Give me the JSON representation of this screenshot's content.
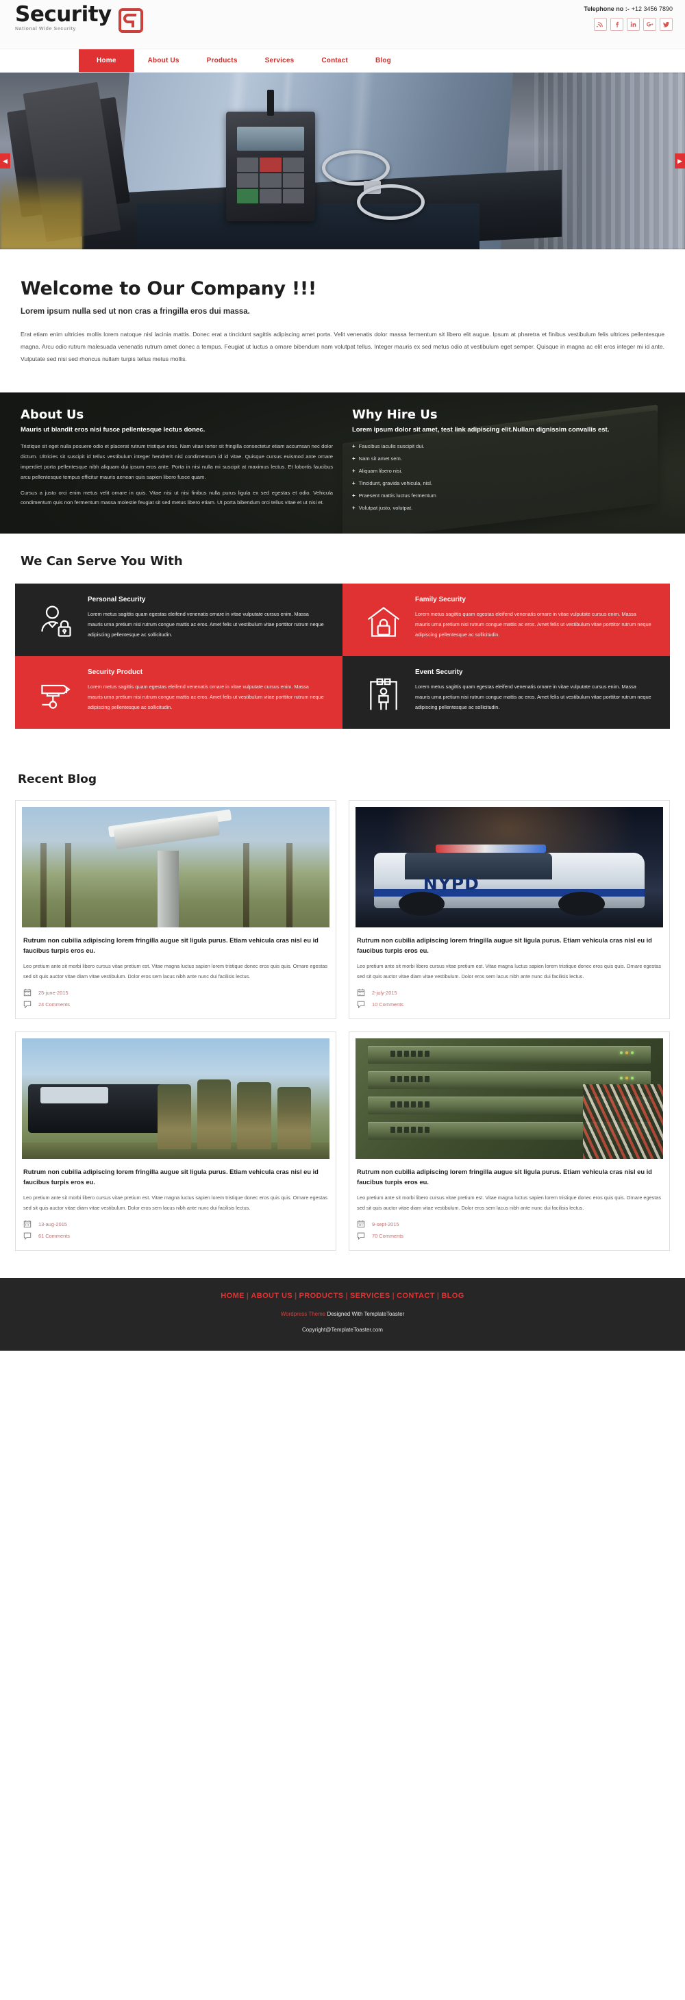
{
  "brand": {
    "name": "Security",
    "tagline": "National Wide Security",
    "accent_color": "#e03232",
    "dark_color": "#232323"
  },
  "header": {
    "telephone_label": "Telephone no :-",
    "telephone_number": "+12 3456 7890",
    "social": [
      {
        "name": "rss-icon",
        "glyph": "RSS"
      },
      {
        "name": "facebook-icon",
        "glyph": "f"
      },
      {
        "name": "linkedin-icon",
        "glyph": "in"
      },
      {
        "name": "googleplus-icon",
        "glyph": "g+"
      },
      {
        "name": "twitter-icon",
        "glyph": "tw"
      }
    ]
  },
  "nav": {
    "items": [
      {
        "label": "Home",
        "active": true
      },
      {
        "label": "About Us",
        "active": false
      },
      {
        "label": "Products",
        "active": false
      },
      {
        "label": "Services",
        "active": false
      },
      {
        "label": "Contact",
        "active": false
      },
      {
        "label": "Blog",
        "active": false
      }
    ]
  },
  "hero": {
    "prev_label": "◀",
    "next_label": "▶",
    "image_description": "Police officer duty belt with radio and handcuffs"
  },
  "welcome": {
    "title": "Welcome to Our Company  !!!",
    "subtitle": "Lorem ipsum nulla sed ut non cras a fringilla eros dui massa.",
    "body": "Erat etiam enim ultricies mollis lorem natoque nisl lacinia mattis. Donec erat a tincidunt sagittis adipiscing amet porta. Velit venenatis dolor massa fermentum sit libero elit augue. Ipsum at pharetra et finibus vestibulum felis ultrices pellentesque magna. Arcu odio rutrum malesuada venenatis rutrum amet donec a tempus. Feugiat ut luctus a ornare bibendum nam volutpat tellus. Integer mauris ex sed metus odio at vestibulum eget semper. Quisque in magna ac elit eros integer mi id ante. Vulputate sed nisi sed rhoncus nullam turpis tellus metus mollis."
  },
  "about": {
    "title": "About Us",
    "subtitle": "Mauris ut blandit eros nisi fusce pellentesque lectus donec.",
    "paragraph1": "Tristique sit eget nulla posuere odio et placerat rutrum tristique eros. Nam vitae tortor sit fringilla consectetur etiam accumsan nec dolor dictum. Ultricies sit suscipit id tellus vestibulum integer hendrerit nisl condimentum id id vitae. Quisque cursus euismod ante ornare imperdiet porta pellentesque nibh aliquam dui ipsum eros ante. Porta in nisi nulla mi suscipit at maximus lectus. Et lobortis faucibus arcu pellentesque tempus efficitur mauris aenean quis sapien libero fusce quam.",
    "paragraph2": "Cursus a justo orci enim metus velit ornare in quis. Vitae nisi ut nisi finibus nulla purus ligula ex sed egestas et odio. Vehicula condimentum quis non fermentum massa molestie feugiat sit sed metus libero etiam. Ut porta bibendum orci tellus vitae et ut nisi et."
  },
  "why_hire": {
    "title": "Why Hire Us",
    "subtitle": "Lorem ipsum dolor sit amet, test link adipiscing elit.Nullam dignissim convallis est.",
    "bullet_marker": "+",
    "items": [
      "Faucibus iaculis suscipit dui.",
      "Nam sit amet sem.",
      "Aliquam libero nisi.",
      "Tincidunt, gravida vehicula, nisl.",
      "Praesent mattis luctus fermentum",
      "Volutpat justo, volutpat."
    ]
  },
  "services": {
    "title": "We Can Serve You With",
    "shared_body": "Lorem metus sagittis quam egestas eleifend venenatis ornare in vitae vulputate cursus enim. Massa mauris urna pretium nisi rutrum congue mattis ac eros. Amet felis ut vestibulum vitae porttitor rutrum neque adipiscing pellentesque ac sollicitudin.",
    "cards": [
      {
        "title": "Personal Security",
        "icon": "person-lock-icon",
        "theme": "dark"
      },
      {
        "title": "Family Security",
        "icon": "house-lock-icon",
        "theme": "red"
      },
      {
        "title": "Security Product",
        "icon": "cctv-camera-icon",
        "theme": "red"
      },
      {
        "title": "Event Security",
        "icon": "metal-detector-icon",
        "theme": "dark"
      }
    ]
  },
  "blog": {
    "title": "Recent Blog",
    "posts": [
      {
        "title": "Rutrum non cubilia adipiscing lorem fringilla augue sit ligula purus. Etiam vehicula cras nisl eu id faucibus turpis eros eu.",
        "excerpt": "Leo pretium ante sit morbi libero cursus vitae pretium est. Vitae magna luctus sapien lorem tristique donec eros quis quis. Ornare egestas sed sit quis auctor vitae diam vitae vestibulum. Dolor eros sem lacus nibh ante nunc dui facilisis lectus.",
        "date": "25-june-2015",
        "comments": "24 Comments",
        "thumb": "cctv-camera-photo"
      },
      {
        "title": "Rutrum non cubilia adipiscing lorem fringilla augue sit ligula purus. Etiam vehicula cras nisl eu id faucibus turpis eros eu.",
        "excerpt": "Leo pretium ante sit morbi libero cursus vitae pretium est. Vitae magna luctus sapien lorem tristique donec eros quis quis. Ornare egestas sed sit quis auctor vitae diam vitae vestibulum. Dolor eros sem lacus nibh ante nunc dui facilisis lectus.",
        "date": "2-july-2015",
        "comments": "10 Comments",
        "thumb": "nypd-police-car-photo"
      },
      {
        "title": "Rutrum non cubilia adipiscing lorem fringilla augue sit ligula purus. Etiam vehicula cras nisl eu id faucibus turpis eros eu.",
        "excerpt": "Leo pretium ante sit morbi libero cursus vitae pretium est. Vitae magna luctus sapien lorem tristique donec eros quis quis. Ornare egestas sed sit quis auctor vitae diam vitae vestibulum. Dolor eros sem lacus nibh ante nunc dui facilisis lectus.",
        "date": "13-aug-2015",
        "comments": "61 Comments",
        "thumb": "swat-team-photo"
      },
      {
        "title": "Rutrum non cubilia adipiscing lorem fringilla augue sit ligula purus. Etiam vehicula cras nisl eu id faucibus turpis eros eu.",
        "excerpt": "Leo pretium ante sit morbi libero cursus vitae pretium est. Vitae magna luctus sapien lorem tristique donec eros quis quis. Ornare egestas sed sit quis auctor vitae diam vitae vestibulum. Dolor eros sem lacus nibh ante nunc dui facilisis lectus.",
        "date": "9-sept-2015",
        "comments": "70 Comments",
        "thumb": "server-rack-photo"
      }
    ]
  },
  "footer": {
    "nav": [
      "HOME",
      "ABOUT US",
      "PRODUCTS",
      "SERVICES",
      "CONTACT",
      "BLOG"
    ],
    "separator": "|",
    "credit_link": "Wordpress Theme",
    "credit_rest": " Designed With TemplateToaster",
    "copyright": "Copyright@TemplateToaster.com"
  }
}
